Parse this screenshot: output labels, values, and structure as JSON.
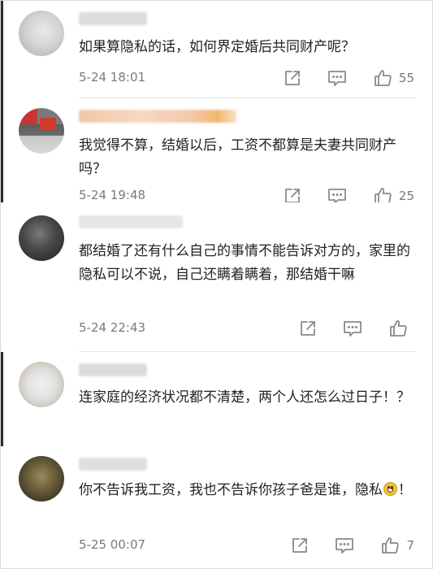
{
  "comments": [
    {
      "text": "如果算隐私的话，如何界定婚后共同财产呢？",
      "timestamp": "5-24 18:01",
      "like_count": "55"
    },
    {
      "text": "我觉得不算，结婚以后，工资不都算是夫妻共同财产吗？",
      "timestamp": "5-24 19:48",
      "like_count": "25"
    },
    {
      "text": "都结婚了还有什么自己的事情不能告诉对方的，家里的隐私可以不说，自己还瞒着瞒着，那结婚干嘛",
      "timestamp": "5-24 22:43",
      "like_count": ""
    },
    {
      "text": "连家庭的经济状况都不清楚，两个人还怎么过日子！？",
      "timestamp": "",
      "like_count": ""
    },
    {
      "text_before_emoji": "你不告诉我工资，我也不告诉你孩子爸是谁，隐私",
      "text_after_emoji": "！",
      "timestamp": "5-25 00:07",
      "like_count": "7"
    }
  ],
  "icons": {
    "share": "share-icon",
    "reply": "comment-icon",
    "like": "thumbs-up-icon",
    "emoji": "smile-emoji-icon"
  },
  "colors": {
    "text": "#222222",
    "meta": "#7a7a7a",
    "icon": "#8a8a8a",
    "divider": "#e6e6e6"
  }
}
